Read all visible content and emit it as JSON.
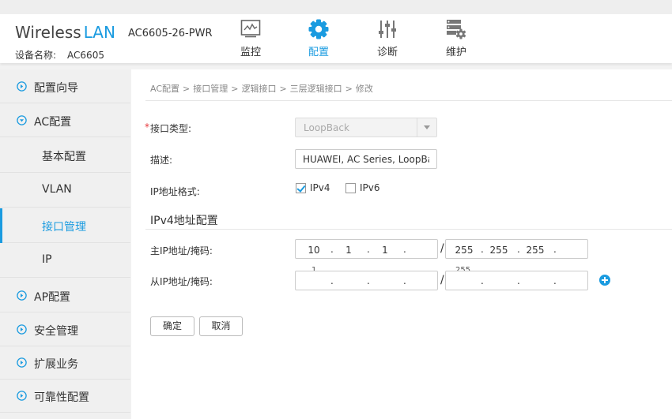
{
  "header": {
    "brand_wireless": "Wireless",
    "brand_lan": "LAN",
    "model": "AC6605-26-PWR",
    "device_name_label": "设备名称:",
    "device_name_value": "AC6605",
    "nav": [
      {
        "label": "监控",
        "icon": "monitor-icon",
        "active": false
      },
      {
        "label": "配置",
        "icon": "gear-icon",
        "active": true
      },
      {
        "label": "诊断",
        "icon": "sliders-icon",
        "active": false
      },
      {
        "label": "维护",
        "icon": "maintenance-icon",
        "active": false
      }
    ],
    "accent_color": "#1a9be0"
  },
  "sidebar": {
    "items": [
      {
        "label": "配置向导",
        "icon": "chevron-right-circle-icon"
      },
      {
        "label": "AC配置",
        "icon": "chevron-down-circle-icon"
      },
      {
        "label": "基本配置"
      },
      {
        "label": "VLAN"
      },
      {
        "label": "接口管理",
        "active": true
      },
      {
        "label": "IP"
      },
      {
        "label": "AP配置",
        "icon": "chevron-right-circle-icon"
      },
      {
        "label": "安全管理",
        "icon": "chevron-right-circle-icon"
      },
      {
        "label": "扩展业务",
        "icon": "chevron-right-circle-icon"
      },
      {
        "label": "可靠性配置",
        "icon": "chevron-right-circle-icon"
      }
    ]
  },
  "breadcrumb": {
    "items": [
      "AC配置",
      "接口管理",
      "逻辑接口",
      "三层逻辑接口",
      "修改"
    ],
    "separator": ">"
  },
  "form": {
    "interface_type_label": "接口类型:",
    "required_mark": "*",
    "interface_type_value": "LoopBack",
    "description_label": "描述:",
    "description_value": "HUAWEI, AC Series, LoopBack",
    "ip_format_label": "IP地址格式:",
    "ipv4_label": "IPv4",
    "ipv4_checked": true,
    "ipv6_label": "IPv6",
    "ipv6_checked": false,
    "section_title": "IPv4地址配置",
    "primary_label": "主IP地址/掩码:",
    "primary_ip": [
      "10",
      "1",
      "1",
      ""
    ],
    "primary_mask": [
      "255",
      "255",
      "255",
      ""
    ],
    "secondary_label": "从IP地址/掩码:",
    "secondary_ip": [
      "",
      "",
      "",
      ""
    ],
    "secondary_mask": [
      "",
      "",
      "",
      ""
    ],
    "ghost_ip": "1",
    "ghost_mask": "255",
    "slash": "/",
    "ok_label": "确定",
    "cancel_label": "取消"
  }
}
